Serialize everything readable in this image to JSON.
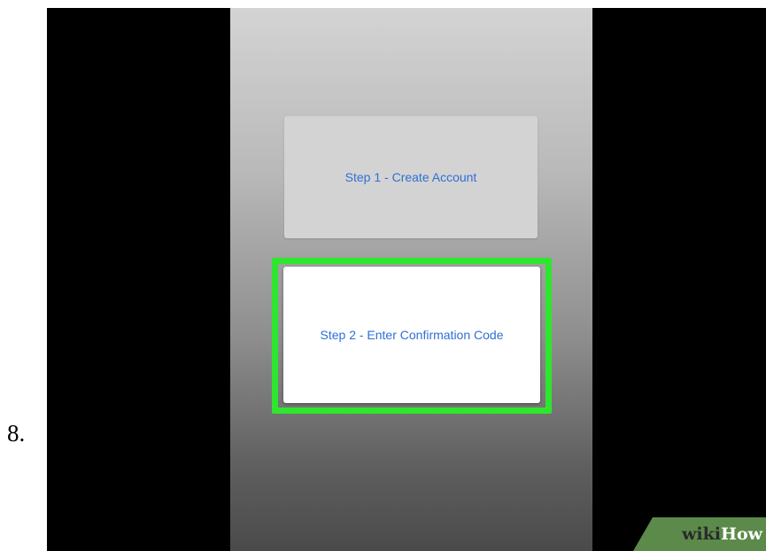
{
  "step_number": "8.",
  "buttons": {
    "step1_label": "Step 1 - Create Account",
    "step2_label": "Step 2 - Enter Confirmation Code"
  },
  "watermark": {
    "wiki": "wiki",
    "how": "How"
  },
  "colors": {
    "link_blue": "#2f6fd6",
    "highlight_green": "#2ee62e",
    "watermark_green": "#5b8a4a"
  }
}
